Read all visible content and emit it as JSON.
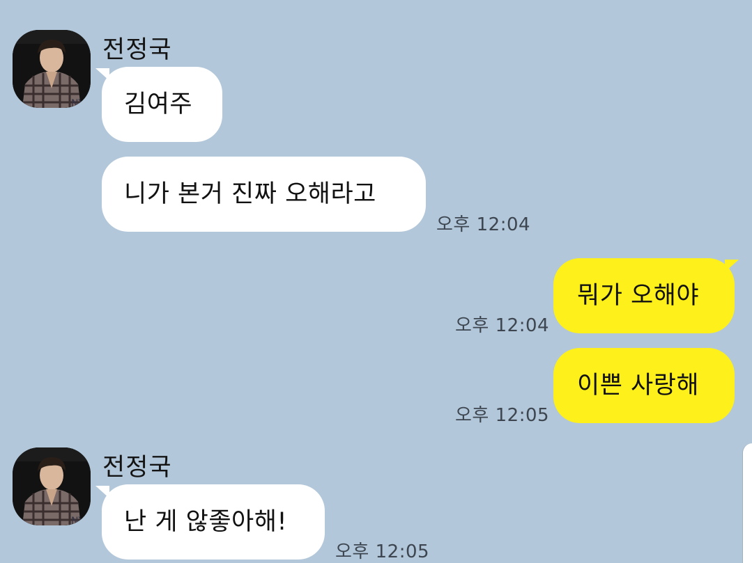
{
  "chat": {
    "background_color": "#b2c7d9",
    "incoming_bubble_color": "#ffffff",
    "outgoing_bubble_color": "#fef01b",
    "groups": [
      {
        "sender": "전정국",
        "avatar_icon": "profile-photo-icon",
        "messages": [
          {
            "text": "김여주",
            "time": ""
          },
          {
            "text": "니가 본거 진짜 오해라고",
            "time": "오후 12:04"
          }
        ]
      },
      {
        "sender": "me",
        "messages": [
          {
            "text": "뭐가 오해야",
            "time": "오후 12:04"
          },
          {
            "text": "이쁜 사랑해",
            "time": "오후 12:05"
          }
        ]
      },
      {
        "sender": "전정국",
        "avatar_icon": "profile-photo-icon",
        "messages": [
          {
            "text": "난 게 않좋아해!",
            "time": "오후 12:05"
          }
        ]
      }
    ]
  }
}
